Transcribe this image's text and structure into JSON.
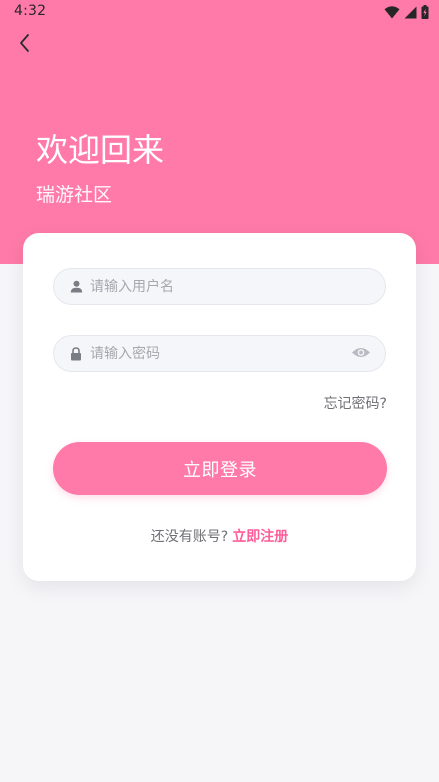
{
  "status_bar": {
    "time": "4:32",
    "icons": [
      "wifi-icon",
      "signal-icon",
      "battery-icon"
    ]
  },
  "header": {
    "back_icon": "chevron-left-icon",
    "title": "欢迎回来",
    "subtitle": "瑞游社区"
  },
  "form": {
    "username": {
      "icon": "person-icon",
      "placeholder": "请输入用户名",
      "value": ""
    },
    "password": {
      "icon": "lock-icon",
      "placeholder": "请输入密码",
      "value": "",
      "toggle_icon": "eye-icon"
    },
    "forgot_password": "忘记密码?",
    "login_button": "立即登录",
    "signup_prompt": "还没有账号?",
    "signup_link": "立即注册"
  },
  "colors": {
    "brand_pink": "#ff7aa8",
    "link_pink": "#ff5c98",
    "background": "#f6f6f9"
  }
}
